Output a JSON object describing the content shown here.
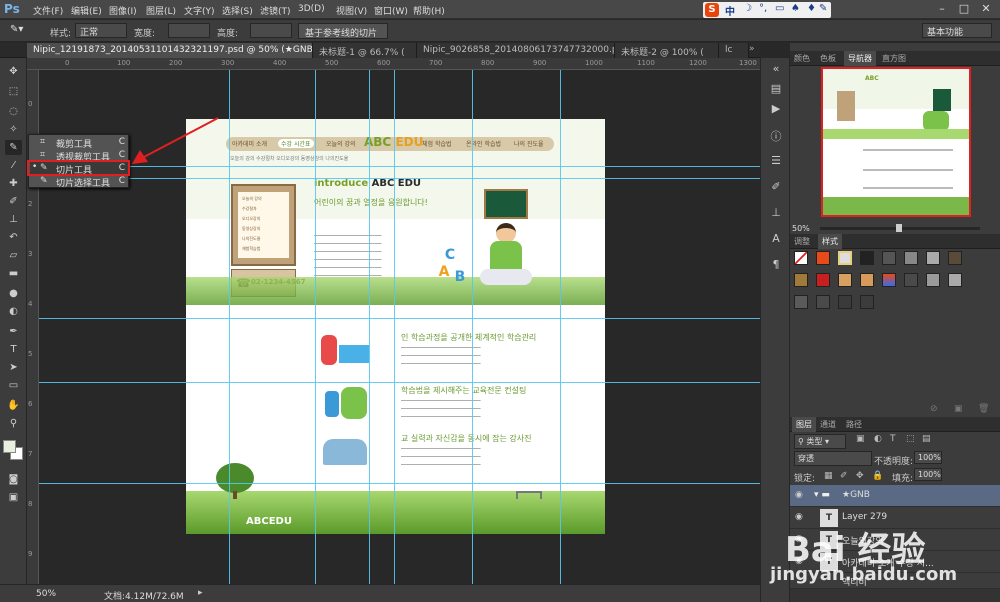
{
  "app": {
    "logo": "Ps"
  },
  "menu": [
    "文件(F)",
    "编辑(E)",
    "图像(I)",
    "图层(L)",
    "文字(Y)",
    "选择(S)",
    "滤镜(T)",
    "3D(D)",
    "视图(V)",
    "窗口(W)",
    "帮助(H)"
  ],
  "ime": {
    "logo": "S",
    "mode": "中"
  },
  "options": {
    "style_label": "样式:",
    "style_value": "正常",
    "width_label": "宽度:",
    "height_label": "高度:",
    "guide_button": "基于参考线的切片",
    "workspace": "基本功能"
  },
  "tabs": [
    {
      "label": "Nipic_12191873_20140531101432321197.psd @ 50% (★GNB, RGB/8) *"
    },
    {
      "label": "未标题-1 @ 66.7% ("
    },
    {
      "label": "Nipic_9026858_20140806173747732000.psd"
    },
    {
      "label": "未标题-2 @ 100% ("
    },
    {
      "label": "lc"
    }
  ],
  "tool_flyout": [
    {
      "label": "裁剪工具",
      "shortcut": "C"
    },
    {
      "label": "透视裁剪工具",
      "shortcut": "C"
    },
    {
      "label": "切片工具",
      "shortcut": "C"
    },
    {
      "label": "切片选择工具",
      "shortcut": "C"
    }
  ],
  "canvas_doc": {
    "nav": [
      "아카데미 소개",
      "수강 시간표",
      "오늘의 강의",
      "체험 학습법",
      "온라인 학습법",
      "나의 진도율"
    ],
    "logo": "ABC",
    "logo2": "EDU",
    "subnav": "오늘의 강의  수강절차  오디오강의  동영상강의  나의진도율",
    "side_items": [
      "오늘의 강의",
      "수강절차",
      "오디오강의",
      "동영상강의",
      "나의진도율",
      "체험학습법"
    ],
    "phone": "02-1234-4567",
    "intro": "introduce",
    "intro2": "ABC EDU",
    "hangul": "어린이의 꿈과 열정을 응원합니다!",
    "sec1": "인 학습과정을 공개한 체계적인 학습관리",
    "sec2": "학습법을 제시해주는 교육전문 컨설팅",
    "sec3": "교 실력과 자신감을 동시에 잡는 강사진",
    "foot_logo": "ABCEDU"
  },
  "rulers": {
    "top": [
      "0",
      "100",
      "200",
      "300",
      "400",
      "500",
      "600",
      "700",
      "800",
      "900",
      "1000",
      "1100",
      "1200",
      "1300"
    ],
    "left": [
      "0",
      "1",
      "2",
      "3",
      "4",
      "5",
      "6",
      "7",
      "8",
      "9"
    ]
  },
  "status": {
    "zoom": "50%",
    "doc": "文档:4.12M/72.6M"
  },
  "panels": {
    "top_tabs": [
      "颜色",
      "色板",
      "导航器",
      "直方图"
    ],
    "nav_zoom": "50%",
    "mid_tabs": [
      "调整",
      "样式"
    ],
    "layer_tabs": [
      "图层",
      "通道",
      "路径"
    ]
  },
  "layers_controls": {
    "kind": "类型",
    "blend": "穿透",
    "opacity_label": "不透明度:",
    "opacity": "100%",
    "lock_label": "锁定:",
    "fill_label": "填充:",
    "fill": "100%"
  },
  "layers": [
    {
      "name": "★GNB"
    },
    {
      "name": "Layer 279"
    },
    {
      "name": "오늘의강의"
    },
    {
      "name": "아카데미 소개    수강 시..."
    },
    {
      "name": "액티비"
    }
  ],
  "watermark": {
    "text": "Bai 经验",
    "url": "jingyan.baidu.com"
  }
}
